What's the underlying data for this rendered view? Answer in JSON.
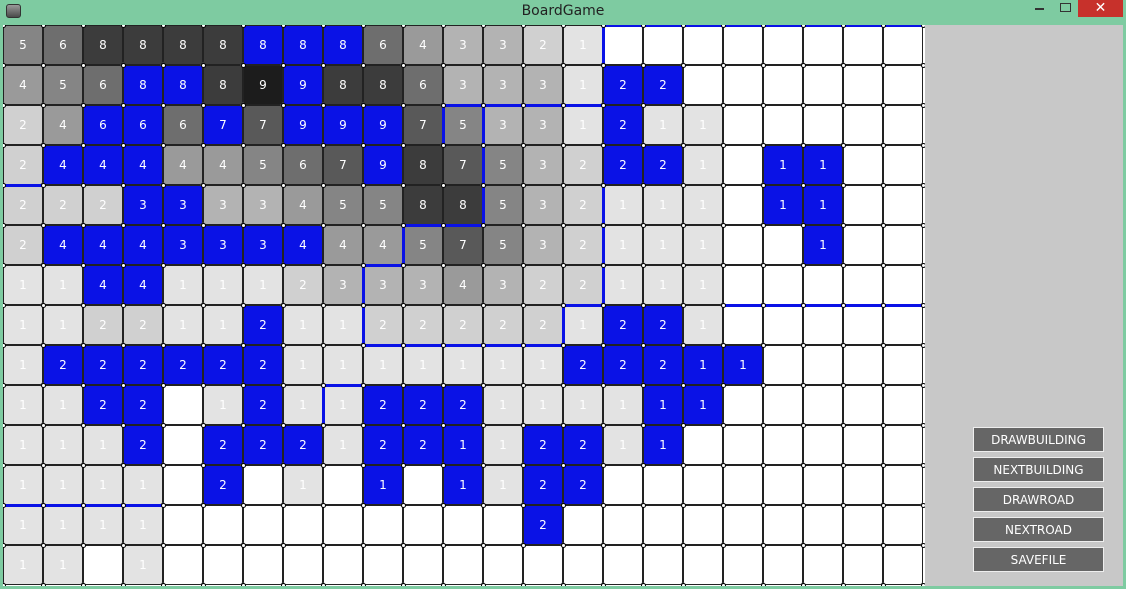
{
  "window": {
    "title": "BoardGame",
    "icon": "app-cube-icon",
    "close_symbol": "✕"
  },
  "colors": {
    "road": "#0a12e6",
    "empty": "#ffffff",
    "height": {
      "1": "#e3e3e3",
      "2": "#d0d0d0",
      "3": "#b3b3b3",
      "4": "#9a9a9a",
      "5": "#858585",
      "6": "#6e6e6e",
      "7": "#595959",
      "8": "#3c3c3c",
      "9": "#1c1c1c"
    }
  },
  "board": {
    "rows": [
      [
        "5",
        "6",
        "8",
        "8",
        "8",
        "8",
        "8B",
        "8B",
        "8B",
        "6",
        "4",
        "3",
        "3",
        "2",
        "1",
        "",
        "",
        "",
        "",
        "",
        "",
        "",
        ""
      ],
      [
        "4",
        "5",
        "6",
        "8B",
        "8B",
        "8",
        "9",
        "9B",
        "8",
        "8",
        "6",
        "3",
        "3",
        "3",
        "1",
        "2B",
        "2B",
        "",
        "",
        "",
        "",
        "",
        ""
      ],
      [
        "2",
        "4",
        "6B",
        "6B",
        "6",
        "7B",
        "7",
        "9B",
        "9B",
        "9B",
        "7",
        "5",
        "3",
        "3",
        "1",
        "2B",
        "1",
        "1",
        "",
        "",
        "",
        "",
        ""
      ],
      [
        "2",
        "4B",
        "4B",
        "4B",
        "4",
        "4",
        "5",
        "6",
        "7",
        "9B",
        "8",
        "7",
        "5",
        "3",
        "2",
        "2B",
        "2B",
        "1",
        "",
        "1B",
        "1B",
        "",
        ""
      ],
      [
        "2",
        "2",
        "2",
        "3B",
        "3B",
        "3",
        "3",
        "4",
        "5",
        "5",
        "8",
        "8",
        "5",
        "3",
        "2",
        "1",
        "1",
        "1",
        "",
        "1B",
        "1B",
        "",
        ""
      ],
      [
        "2",
        "4B",
        "4B",
        "4B",
        "3B",
        "3B",
        "3B",
        "4B",
        "4",
        "4",
        "5",
        "7",
        "5",
        "3",
        "2",
        "1",
        "1",
        "1",
        "",
        "",
        "1B",
        "",
        ""
      ],
      [
        "1",
        "1",
        "4B",
        "4B",
        "1",
        "1",
        "1",
        "2",
        "3",
        "3",
        "3",
        "4",
        "3",
        "2",
        "2",
        "1",
        "1",
        "1",
        "",
        "",
        "",
        "",
        ""
      ],
      [
        "1",
        "1",
        "2",
        "2",
        "1",
        "1",
        "2B",
        "1",
        "1",
        "2",
        "2",
        "2",
        "2",
        "2",
        "1",
        "2B",
        "2B",
        "1",
        "",
        "",
        "",
        "",
        ""
      ],
      [
        "1",
        "2B",
        "2B",
        "2B",
        "2B",
        "2B",
        "2B",
        "1",
        "1",
        "1",
        "1",
        "1",
        "1",
        "1",
        "2B",
        "2B",
        "2B",
        "1B",
        "1B",
        "",
        "",
        "",
        ""
      ],
      [
        "1",
        "1",
        "2B",
        "2B",
        "",
        "1",
        "2B",
        "1",
        "1",
        "2B",
        "2B",
        "2B",
        "1",
        "1",
        "1",
        "1",
        "1B",
        "1B",
        "",
        "",
        "",
        "",
        ""
      ],
      [
        "1",
        "1",
        "1",
        "2B",
        "",
        "2B",
        "2B",
        "2B",
        "1",
        "2B",
        "2B",
        "1B",
        "1",
        "2B",
        "2B",
        "1",
        "1B",
        "",
        "",
        "",
        "",
        "",
        ""
      ],
      [
        "1",
        "1",
        "1",
        "1",
        "",
        "2B",
        "",
        "1",
        "",
        "1B",
        "",
        "1B",
        "1",
        "2B",
        "2B",
        "",
        "",
        "",
        "",
        "",
        "",
        "",
        ""
      ],
      [
        "1",
        "1",
        "1",
        "1",
        "",
        "",
        "",
        "",
        "",
        "",
        "",
        "",
        "",
        "2B",
        "",
        "",
        "",
        "",
        "",
        "",
        "",
        "",
        ""
      ],
      [
        "1",
        "1",
        "",
        "1",
        "",
        "",
        "",
        "",
        "",
        "",
        "",
        "",
        "",
        "",
        "",
        "",
        "",
        "",
        "",
        "",
        "",
        "",
        ""
      ]
    ]
  },
  "panel": {
    "buttons": [
      {
        "label": "DRAWBUILDING"
      },
      {
        "label": "NEXTBUILDING"
      },
      {
        "label": "DRAWROAD"
      },
      {
        "label": "NEXTROAD"
      },
      {
        "label": "SAVEFILE"
      }
    ]
  }
}
